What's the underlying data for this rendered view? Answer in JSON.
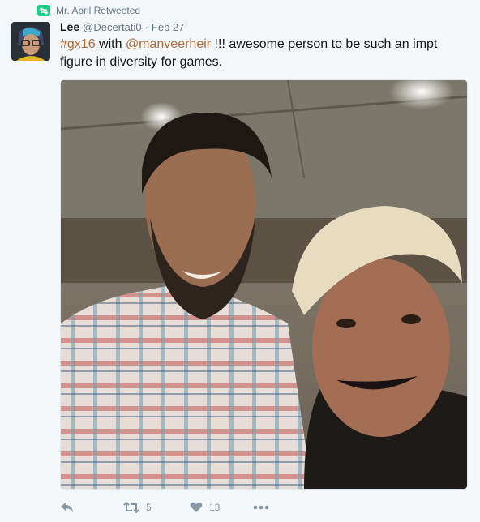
{
  "retweet": {
    "text": "Mr. April Retweeted",
    "icon": "retweet-badge-icon",
    "color": "#19cf86"
  },
  "tweet": {
    "author_name": "Lee",
    "author_handle": "@Decertati0",
    "separator": "·",
    "date": "Feb 27",
    "hashtag": "#gx16",
    "text_part1": " with ",
    "mention": "@manveerheir",
    "text_part2": " !!! awesome person to be such an impt figure in diversity for games.",
    "link_color": "#b26a35",
    "photo_description_icon": "selfie-photo"
  },
  "actions": {
    "reply_icon": "reply-icon",
    "retweet_icon": "retweet-icon",
    "retweet_count": "5",
    "like_icon": "heart-icon",
    "like_count": "13",
    "more_icon": "more-icon"
  }
}
